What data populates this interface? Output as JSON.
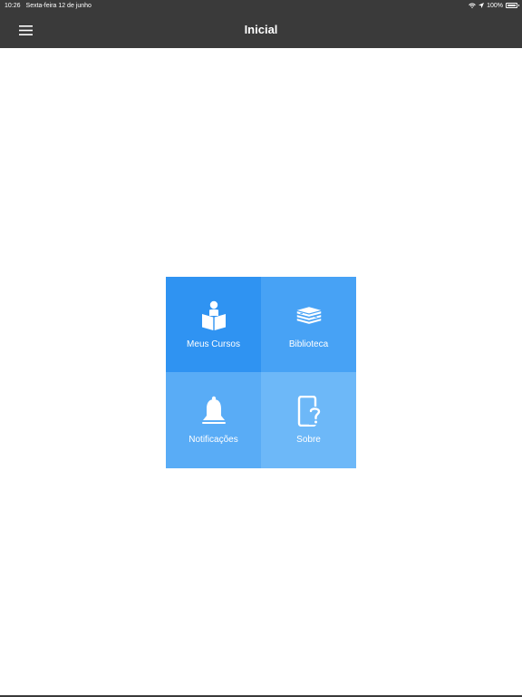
{
  "status_bar": {
    "time": "10:26",
    "date": "Sexta-feira 12 de junho",
    "battery": "100%"
  },
  "navbar": {
    "title": "Inicial",
    "background": "#3a3a3a"
  },
  "tiles": [
    {
      "label": "Meus Cursos",
      "icon": "student-book-icon",
      "color": "#2f93f2"
    },
    {
      "label": "Biblioteca",
      "icon": "books-stack-icon",
      "color": "#47a2f5"
    },
    {
      "label": "Notificações",
      "icon": "bell-icon",
      "color": "#59acf6"
    },
    {
      "label": "Sobre",
      "icon": "phone-question-icon",
      "color": "#6db8f8"
    }
  ]
}
